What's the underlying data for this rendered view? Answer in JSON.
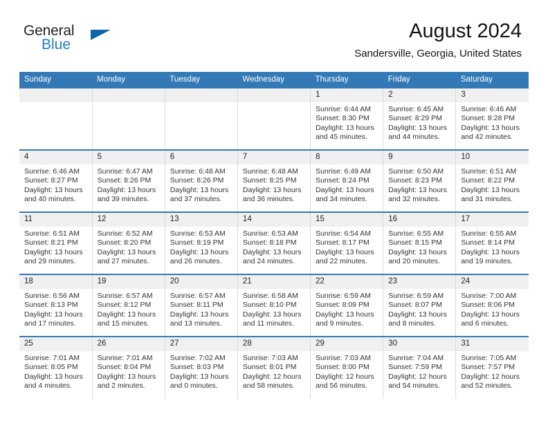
{
  "brand": {
    "line1": "General",
    "line2": "Blue",
    "flag_icon": "triangle-flag-icon",
    "line1_color": "#222222",
    "line2_color": "#1f7ec4",
    "flag_color": "#1065a8"
  },
  "header": {
    "title": "August 2024",
    "subtitle": "Sandersville, Georgia, United States"
  },
  "theme": {
    "header_blue": "#3379b5",
    "daynum_band": "#f0f0f0",
    "cell_border": "#d9d9d9"
  },
  "calendar": {
    "weekday_headers": [
      "Sunday",
      "Monday",
      "Tuesday",
      "Wednesday",
      "Thursday",
      "Friday",
      "Saturday"
    ],
    "labels": {
      "sunrise": "Sunrise:",
      "sunset": "Sunset:",
      "daylight": "Daylight:"
    },
    "weeks": [
      [
        {
          "day": "",
          "sunrise": "",
          "sunset": "",
          "daylight": ""
        },
        {
          "day": "",
          "sunrise": "",
          "sunset": "",
          "daylight": ""
        },
        {
          "day": "",
          "sunrise": "",
          "sunset": "",
          "daylight": ""
        },
        {
          "day": "",
          "sunrise": "",
          "sunset": "",
          "daylight": ""
        },
        {
          "day": "1",
          "sunrise": "Sunrise: 6:44 AM",
          "sunset": "Sunset: 8:30 PM",
          "daylight": "Daylight: 13 hours and 45 minutes."
        },
        {
          "day": "2",
          "sunrise": "Sunrise: 6:45 AM",
          "sunset": "Sunset: 8:29 PM",
          "daylight": "Daylight: 13 hours and 44 minutes."
        },
        {
          "day": "3",
          "sunrise": "Sunrise: 6:46 AM",
          "sunset": "Sunset: 8:28 PM",
          "daylight": "Daylight: 13 hours and 42 minutes."
        }
      ],
      [
        {
          "day": "4",
          "sunrise": "Sunrise: 6:46 AM",
          "sunset": "Sunset: 8:27 PM",
          "daylight": "Daylight: 13 hours and 40 minutes."
        },
        {
          "day": "5",
          "sunrise": "Sunrise: 6:47 AM",
          "sunset": "Sunset: 8:26 PM",
          "daylight": "Daylight: 13 hours and 39 minutes."
        },
        {
          "day": "6",
          "sunrise": "Sunrise: 6:48 AM",
          "sunset": "Sunset: 8:26 PM",
          "daylight": "Daylight: 13 hours and 37 minutes."
        },
        {
          "day": "7",
          "sunrise": "Sunrise: 6:48 AM",
          "sunset": "Sunset: 8:25 PM",
          "daylight": "Daylight: 13 hours and 36 minutes."
        },
        {
          "day": "8",
          "sunrise": "Sunrise: 6:49 AM",
          "sunset": "Sunset: 8:24 PM",
          "daylight": "Daylight: 13 hours and 34 minutes."
        },
        {
          "day": "9",
          "sunrise": "Sunrise: 6:50 AM",
          "sunset": "Sunset: 8:23 PM",
          "daylight": "Daylight: 13 hours and 32 minutes."
        },
        {
          "day": "10",
          "sunrise": "Sunrise: 6:51 AM",
          "sunset": "Sunset: 8:22 PM",
          "daylight": "Daylight: 13 hours and 31 minutes."
        }
      ],
      [
        {
          "day": "11",
          "sunrise": "Sunrise: 6:51 AM",
          "sunset": "Sunset: 8:21 PM",
          "daylight": "Daylight: 13 hours and 29 minutes."
        },
        {
          "day": "12",
          "sunrise": "Sunrise: 6:52 AM",
          "sunset": "Sunset: 8:20 PM",
          "daylight": "Daylight: 13 hours and 27 minutes."
        },
        {
          "day": "13",
          "sunrise": "Sunrise: 6:53 AM",
          "sunset": "Sunset: 8:19 PM",
          "daylight": "Daylight: 13 hours and 26 minutes."
        },
        {
          "day": "14",
          "sunrise": "Sunrise: 6:53 AM",
          "sunset": "Sunset: 8:18 PM",
          "daylight": "Daylight: 13 hours and 24 minutes."
        },
        {
          "day": "15",
          "sunrise": "Sunrise: 6:54 AM",
          "sunset": "Sunset: 8:17 PM",
          "daylight": "Daylight: 13 hours and 22 minutes."
        },
        {
          "day": "16",
          "sunrise": "Sunrise: 6:55 AM",
          "sunset": "Sunset: 8:15 PM",
          "daylight": "Daylight: 13 hours and 20 minutes."
        },
        {
          "day": "17",
          "sunrise": "Sunrise: 6:55 AM",
          "sunset": "Sunset: 8:14 PM",
          "daylight": "Daylight: 13 hours and 19 minutes."
        }
      ],
      [
        {
          "day": "18",
          "sunrise": "Sunrise: 6:56 AM",
          "sunset": "Sunset: 8:13 PM",
          "daylight": "Daylight: 13 hours and 17 minutes."
        },
        {
          "day": "19",
          "sunrise": "Sunrise: 6:57 AM",
          "sunset": "Sunset: 8:12 PM",
          "daylight": "Daylight: 13 hours and 15 minutes."
        },
        {
          "day": "20",
          "sunrise": "Sunrise: 6:57 AM",
          "sunset": "Sunset: 8:11 PM",
          "daylight": "Daylight: 13 hours and 13 minutes."
        },
        {
          "day": "21",
          "sunrise": "Sunrise: 6:58 AM",
          "sunset": "Sunset: 8:10 PM",
          "daylight": "Daylight: 13 hours and 11 minutes."
        },
        {
          "day": "22",
          "sunrise": "Sunrise: 6:59 AM",
          "sunset": "Sunset: 8:09 PM",
          "daylight": "Daylight: 13 hours and 9 minutes."
        },
        {
          "day": "23",
          "sunrise": "Sunrise: 6:59 AM",
          "sunset": "Sunset: 8:07 PM",
          "daylight": "Daylight: 13 hours and 8 minutes."
        },
        {
          "day": "24",
          "sunrise": "Sunrise: 7:00 AM",
          "sunset": "Sunset: 8:06 PM",
          "daylight": "Daylight: 13 hours and 6 minutes."
        }
      ],
      [
        {
          "day": "25",
          "sunrise": "Sunrise: 7:01 AM",
          "sunset": "Sunset: 8:05 PM",
          "daylight": "Daylight: 13 hours and 4 minutes."
        },
        {
          "day": "26",
          "sunrise": "Sunrise: 7:01 AM",
          "sunset": "Sunset: 8:04 PM",
          "daylight": "Daylight: 13 hours and 2 minutes."
        },
        {
          "day": "27",
          "sunrise": "Sunrise: 7:02 AM",
          "sunset": "Sunset: 8:03 PM",
          "daylight": "Daylight: 13 hours and 0 minutes."
        },
        {
          "day": "28",
          "sunrise": "Sunrise: 7:03 AM",
          "sunset": "Sunset: 8:01 PM",
          "daylight": "Daylight: 12 hours and 58 minutes."
        },
        {
          "day": "29",
          "sunrise": "Sunrise: 7:03 AM",
          "sunset": "Sunset: 8:00 PM",
          "daylight": "Daylight: 12 hours and 56 minutes."
        },
        {
          "day": "30",
          "sunrise": "Sunrise: 7:04 AM",
          "sunset": "Sunset: 7:59 PM",
          "daylight": "Daylight: 12 hours and 54 minutes."
        },
        {
          "day": "31",
          "sunrise": "Sunrise: 7:05 AM",
          "sunset": "Sunset: 7:57 PM",
          "daylight": "Daylight: 12 hours and 52 minutes."
        }
      ]
    ]
  }
}
